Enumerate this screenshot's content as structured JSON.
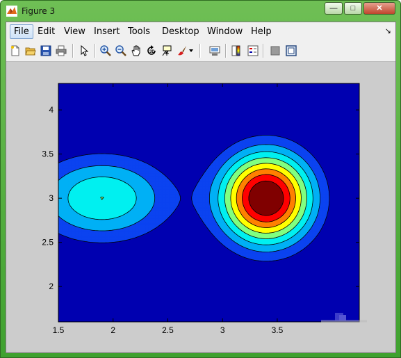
{
  "window": {
    "title": "Figure 3",
    "controls": {
      "minimize": "—",
      "maximize": "□",
      "close": "✕"
    }
  },
  "menubar": {
    "items": [
      "File",
      "Edit",
      "View",
      "Insert",
      "Tools",
      "Desktop",
      "Window",
      "Help"
    ],
    "active": "File",
    "overflow_arrow": "↘"
  },
  "toolbar": {
    "buttons": [
      "new-figure-icon",
      "open-file-icon",
      "save-icon",
      "print-icon",
      "pointer-icon",
      "zoom-in-icon",
      "zoom-out-icon",
      "pan-hand-icon",
      "rotate-3d-icon",
      "data-cursor-icon",
      "brush-icon",
      "link-plot-icon",
      "colorbar-icon",
      "legend-icon",
      "hide-plot-tools-icon",
      "show-plot-tools-icon"
    ]
  },
  "chart_data": {
    "type": "filled-contour",
    "title": "",
    "xlabel": "",
    "ylabel": "",
    "xlim": [
      1.5,
      4.25
    ],
    "ylim": [
      1.6,
      4.3
    ],
    "x_ticks": [
      "1.5",
      "2",
      "2.5",
      "3",
      "3.5"
    ],
    "y_ticks": [
      "2",
      "2.5",
      "3",
      "3.5",
      "4"
    ],
    "colormap": "jet",
    "levels": 9,
    "peak": {
      "x": 3.4,
      "y": 3.0
    },
    "secondary_lobe": {
      "x": 1.9,
      "y": 3.0
    },
    "colors": [
      "#0000b0",
      "#0b43f0",
      "#00b0f5",
      "#00f0f0",
      "#80ff80",
      "#ffff00",
      "#ff8000",
      "#ff0000",
      "#800000"
    ],
    "grid": false,
    "legend": "none"
  }
}
